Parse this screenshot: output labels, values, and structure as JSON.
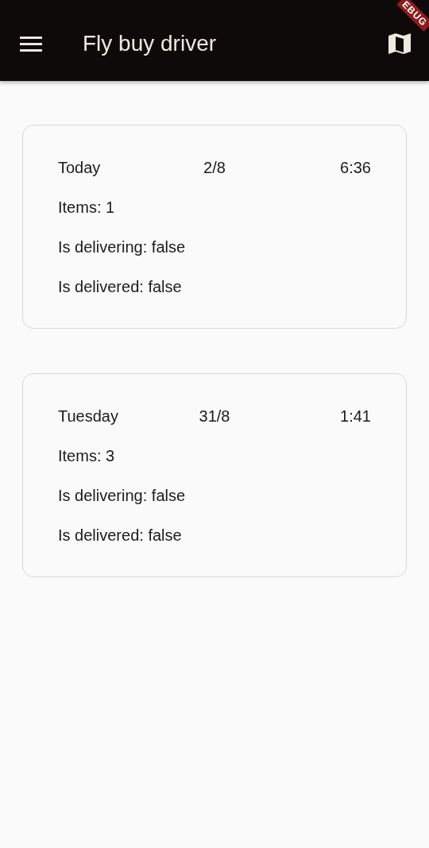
{
  "app_bar": {
    "title": "Fly buy driver",
    "debug_banner": "EBUG"
  },
  "orders": [
    {
      "day": "Today",
      "date": "2/8",
      "time": "6:36",
      "items": "Items: 1",
      "delivering": "Is delivering: false",
      "delivered": "Is delivered: false"
    },
    {
      "day": "Tuesday",
      "date": "31/8",
      "time": "1:41",
      "items": "Items: 3",
      "delivering": "Is delivering: false",
      "delivered": "Is delivered: false"
    }
  ]
}
